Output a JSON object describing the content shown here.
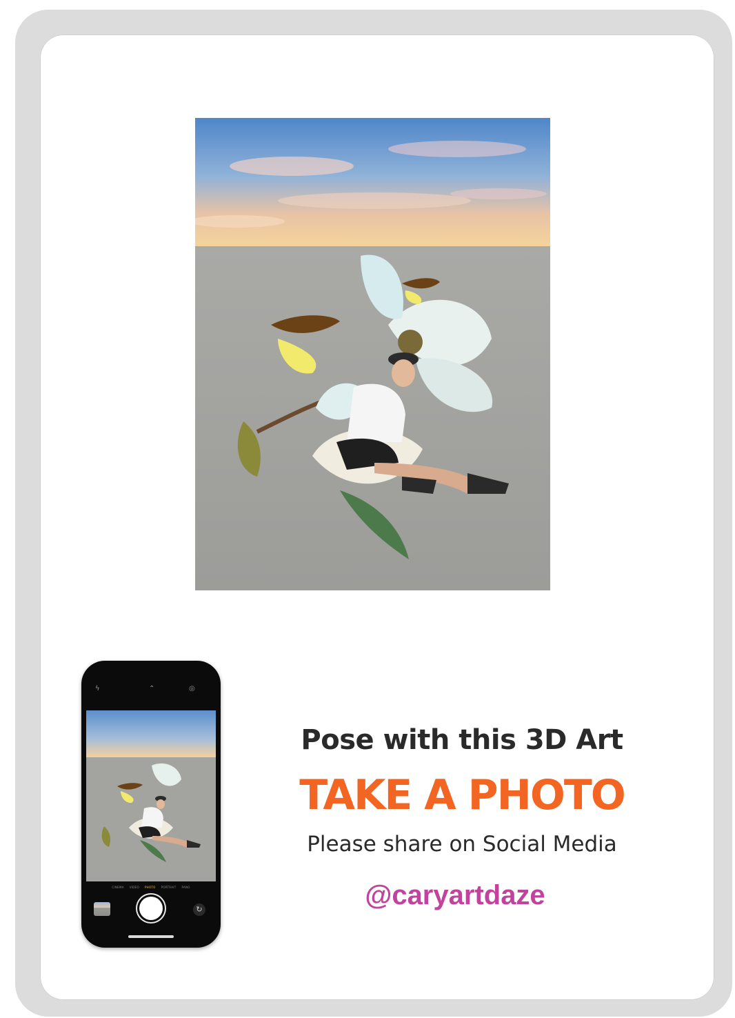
{
  "poster": {
    "headline": "Pose with this 3D Art",
    "call_to_action": "TAKE A PHOTO",
    "share_text": "Please share on Social Media",
    "handle": "@caryartdaze"
  },
  "phone": {
    "icons": [
      "flash-icon",
      "chevron-up-icon",
      "live-photo-icon"
    ],
    "modes": [
      "CINEMA",
      "VIDEO",
      "PHOTO",
      "PORTRAIT",
      "PANO"
    ],
    "active_mode": "PHOTO"
  },
  "colors": {
    "headline": "#2a2a2a",
    "call_to_action": "#f26522",
    "handle": "#c2439e",
    "frame": "#dcdcdc"
  }
}
